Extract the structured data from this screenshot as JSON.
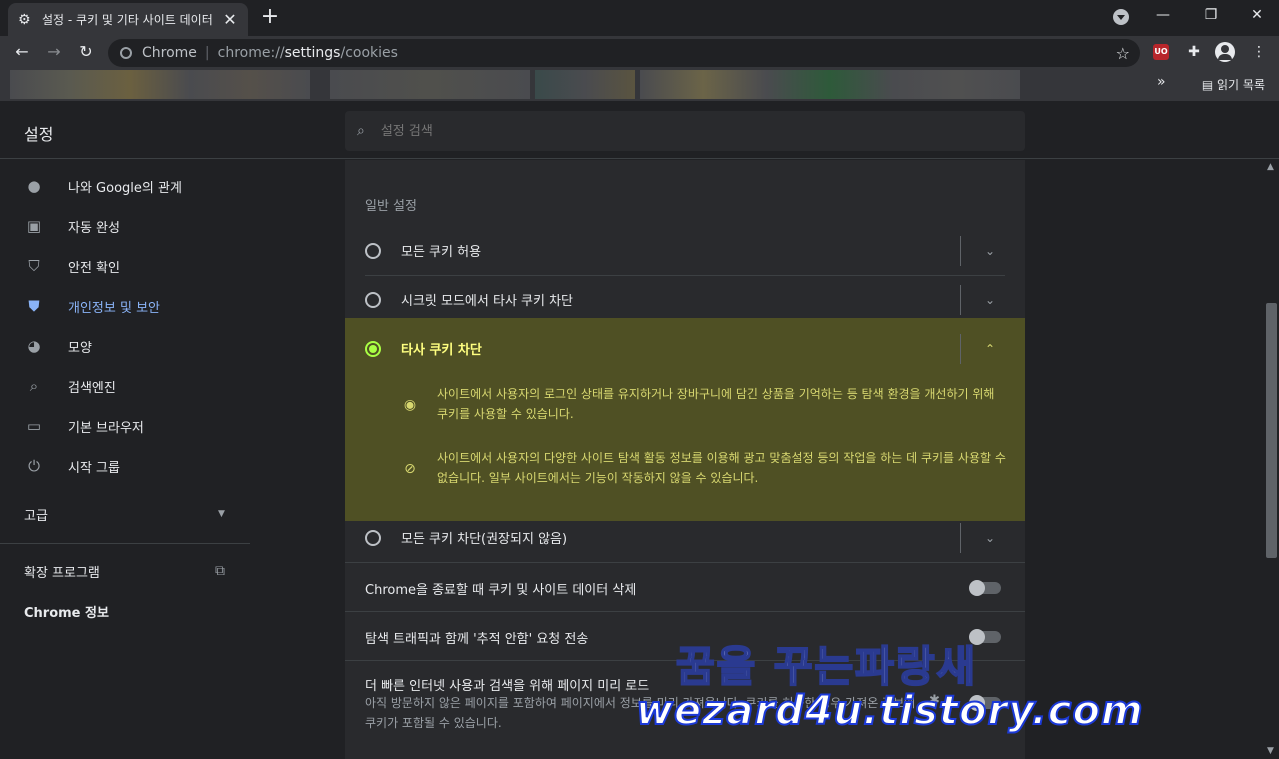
{
  "tab": {
    "icon": "gear-icon",
    "title": "설정 - 쿠키 및 기타 사이트 데이터",
    "close": "✕"
  },
  "newtab": "+",
  "window": {
    "minimize": "—",
    "restore": "❐",
    "close": "✕"
  },
  "omnibox": {
    "label": "Chrome",
    "url_prefix": "chrome://",
    "url_host": "settings",
    "url_path": "/cookies"
  },
  "bookmarks": {
    "reading_list": "읽기 목록",
    "more": "»"
  },
  "app_title": "설정",
  "search": {
    "placeholder": "설정 검색"
  },
  "sidebar": {
    "items": [
      {
        "label": "나와 Google의 관계",
        "icon": "person-icon"
      },
      {
        "label": "자동 완성",
        "icon": "clipboard-icon"
      },
      {
        "label": "안전 확인",
        "icon": "shield-check-icon"
      },
      {
        "label": "개인정보 및 보안",
        "icon": "shield-icon"
      },
      {
        "label": "모양",
        "icon": "palette-icon"
      },
      {
        "label": "검색엔진",
        "icon": "search-icon"
      },
      {
        "label": "기본 브라우저",
        "icon": "browser-icon"
      },
      {
        "label": "시작 그룹",
        "icon": "power-icon"
      }
    ],
    "advanced": "고급",
    "extensions": "확장 프로그램",
    "about": "Chrome 정보"
  },
  "main": {
    "section_title": "일반 설정",
    "options": [
      {
        "label": "모든 쿠키 허용"
      },
      {
        "label": "시크릿 모드에서 타사 쿠키 차단"
      },
      {
        "label": "타사 쿠키 차단"
      },
      {
        "label": "모든 쿠키 차단(권장되지 않음)"
      }
    ],
    "desc1": "사이트에서 사용자의 로그인 상태를 유지하거나 장바구니에 담긴 상품을 기억하는 등 탐색 환경을 개선하기 위해 쿠키를 사용할 수 있습니다.",
    "desc2": "사이트에서 사용자의 다양한 사이트 탐색 활동 정보를 이용해 광고 맞춤설정 등의 작업을 하는 데 쿠키를 사용할 수 없습니다. 일부 사이트에서는 기능이 작동하지 않을 수 있습니다.",
    "toggles": [
      {
        "label": "Chrome을 종료할 때 쿠키 및 사이트 데이터 삭제",
        "on": false
      },
      {
        "label": "탐색 트래픽과 함께 '추적 안함' 요청 전송",
        "on": false
      },
      {
        "label": "더 빠른 인터넷 사용과 검색을 위해 페이지 미리 로드",
        "on": false
      }
    ],
    "preload_sub": "아직 방문하지 않은 페이지를 포함하여 페이지에서 정보를 미리 가져옵니다. 쿠키를 허용한 경우 가져온 정보에 쿠키가 포함될 수 있습니다."
  },
  "watermark": {
    "line1": "꿈을 꾸는파랑새",
    "line2": "wezard4u.tistory.com"
  },
  "colors": {
    "accent": "#8ab4f8",
    "highlight": "#ffff00",
    "bg": "#202124",
    "panel": "#292a2d"
  }
}
